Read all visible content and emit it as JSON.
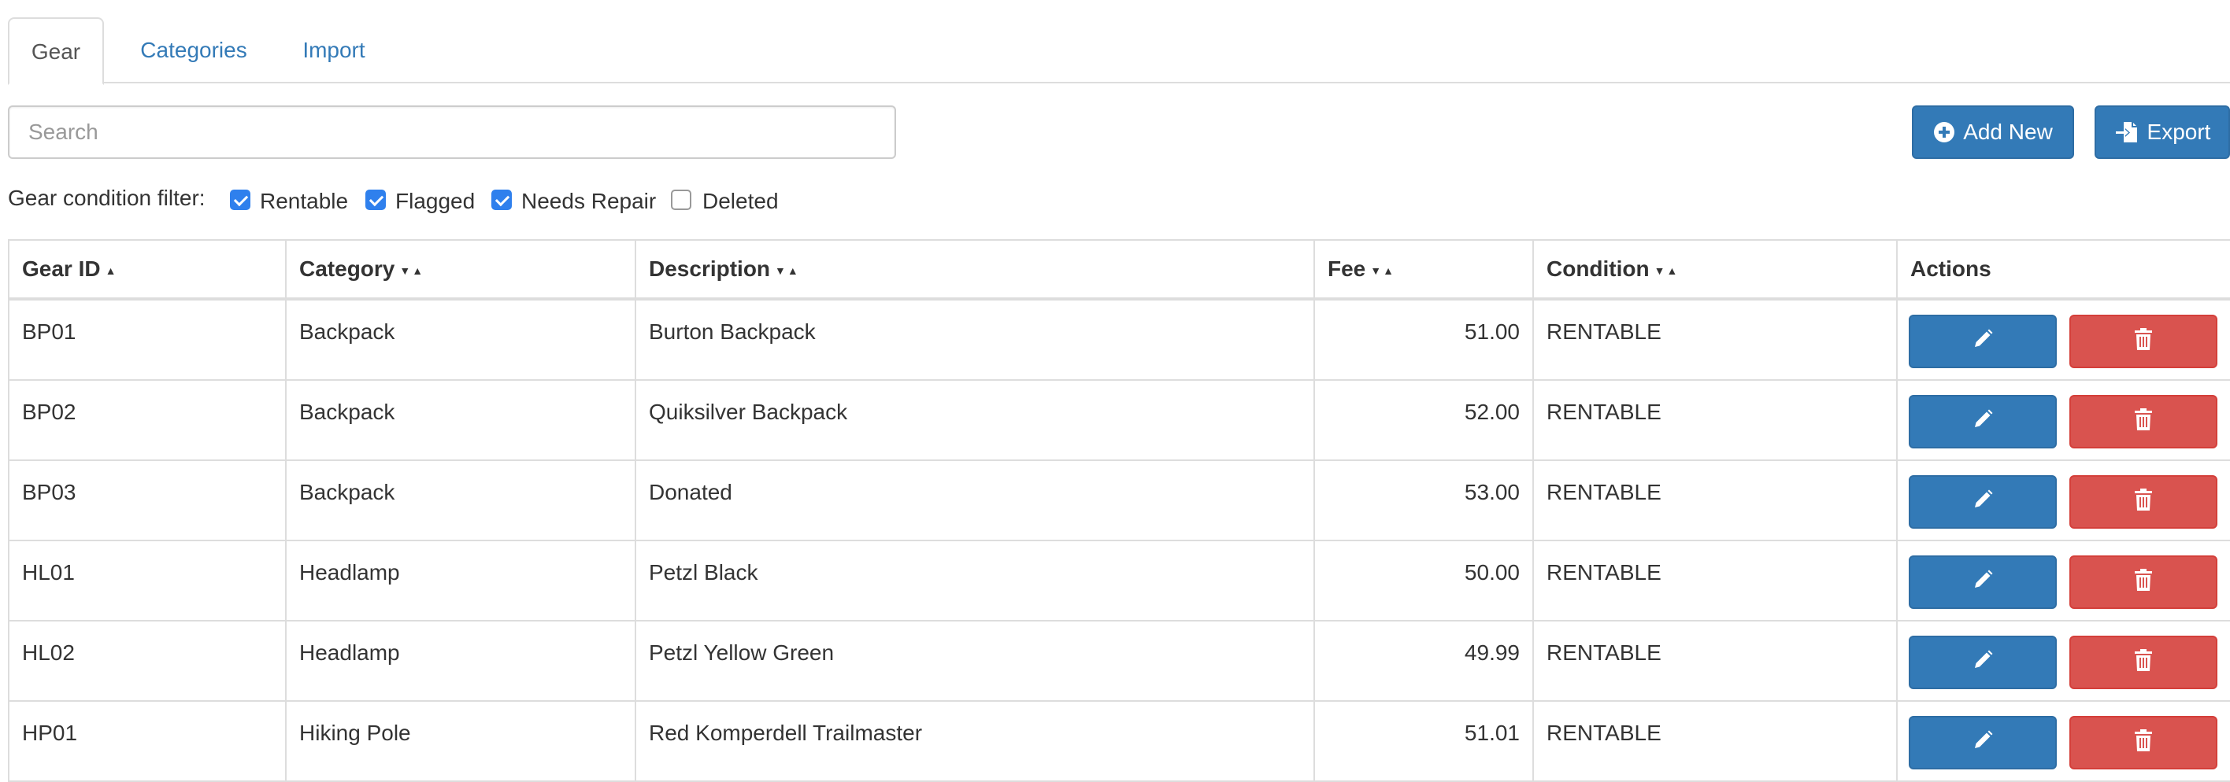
{
  "tabs": [
    {
      "label": "Gear",
      "active": true
    },
    {
      "label": "Categories",
      "active": false
    },
    {
      "label": "Import",
      "active": false
    }
  ],
  "toolbar": {
    "search_placeholder": "Search",
    "add_label": "Add New",
    "add_icon": "plus-circle-icon",
    "export_label": "Export",
    "export_icon": "export-file-icon"
  },
  "filter": {
    "label": "Gear condition filter:",
    "options": [
      {
        "label": "Rentable",
        "checked": true
      },
      {
        "label": "Flagged",
        "checked": true
      },
      {
        "label": "Needs Repair",
        "checked": true
      },
      {
        "label": "Deleted",
        "checked": false
      }
    ]
  },
  "table": {
    "headers": [
      "Gear ID",
      "Category",
      "Description",
      "Fee",
      "Condition",
      "Actions"
    ],
    "rows": [
      {
        "id": "BP01",
        "category": "Backpack",
        "description": "Burton Backpack",
        "fee": "51.00",
        "condition": "RENTABLE"
      },
      {
        "id": "BP02",
        "category": "Backpack",
        "description": "Quiksilver Backpack",
        "fee": "52.00",
        "condition": "RENTABLE"
      },
      {
        "id": "BP03",
        "category": "Backpack",
        "description": "Donated",
        "fee": "53.00",
        "condition": "RENTABLE"
      },
      {
        "id": "HL01",
        "category": "Headlamp",
        "description": "Petzl Black",
        "fee": "50.00",
        "condition": "RENTABLE"
      },
      {
        "id": "HL02",
        "category": "Headlamp",
        "description": "Petzl Yellow Green",
        "fee": "49.99",
        "condition": "RENTABLE"
      },
      {
        "id": "HP01",
        "category": "Hiking Pole",
        "description": "Red Komperdell Trailmaster",
        "fee": "51.01",
        "condition": "RENTABLE"
      }
    ],
    "actions": {
      "edit_icon": "pencil-icon",
      "delete_icon": "trash-icon"
    }
  },
  "colors": {
    "primary": "#337ab7",
    "danger": "#d9534f",
    "checkbox": "#2f80ed",
    "border": "#dddddd"
  }
}
